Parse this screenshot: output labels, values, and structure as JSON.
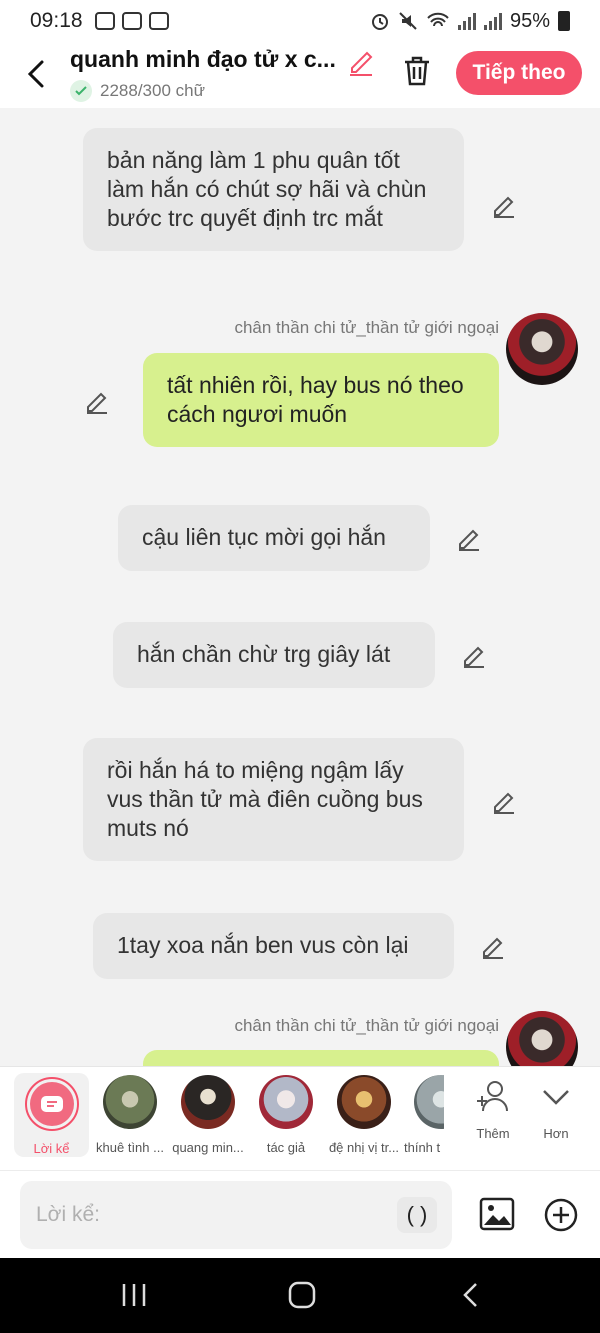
{
  "status": {
    "time": "09:18",
    "battery": "95%"
  },
  "header": {
    "title": "quanh minh đạo tử x c...",
    "word_count": "2288/300 chữ",
    "next_label": "Tiếp theo"
  },
  "messages": [
    {
      "text": "bản năng làm 1 phu quân tốt làm hắn có chút sợ hãi và chùn bước trc quyết định trc mắt"
    },
    {
      "sender": "chân thần chi tử_thần tử giới ngoại",
      "text": "tất nhiên rồi,  hay bus nó theo cách ngươi muốn"
    },
    {
      "text": "cậu liên tục mời gọi hắn"
    },
    {
      "text": "hắn chần chừ trg giây lát"
    },
    {
      "text": "rồi hắn há to miệng ngậm lấy vus thần tử  mà điên cuồng bus muts nó"
    },
    {
      "text": "1tay xoa nắn ben vus còn lại"
    },
    {
      "sender": "chân thần chi tử_thần tử giới ngoại",
      "text": ""
    }
  ],
  "characters": [
    {
      "name": "Lời kể",
      "color": "#f4506a"
    },
    {
      "name": "khuê tình ...",
      "color": "#6b7a55"
    },
    {
      "name": "quang min...",
      "color": "#2a2624"
    },
    {
      "name": "tác giả",
      "color": "#b2b8c8"
    },
    {
      "name": "đệ nhị vị tr...",
      "color": "#8a4a2a"
    },
    {
      "name": "thính t",
      "color": "#9aa5a8"
    }
  ],
  "actions": {
    "add_label": "Thêm",
    "more_label": "Hơn"
  },
  "input": {
    "placeholder": "Lời kể:",
    "paren_button": "( )"
  }
}
